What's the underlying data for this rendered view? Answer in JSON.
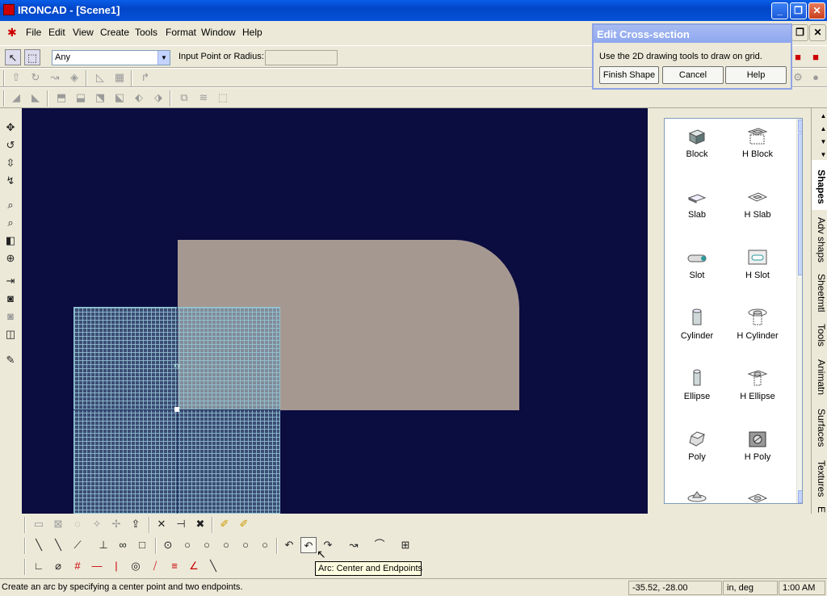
{
  "app": {
    "title": "IRONCAD - [Scene1]"
  },
  "window_buttons": {
    "minimize": "_",
    "restore": "❐",
    "close": "✕"
  },
  "menus": [
    "File",
    "Edit",
    "View",
    "Create",
    "Tools",
    "Format",
    "Window",
    "Help"
  ],
  "selection_toolbar": {
    "filter_value": "Any",
    "input_label": "Input Point or Radius:",
    "input_value": ""
  },
  "dialog": {
    "title": "Edit Cross-section",
    "message": "Use the 2D drawing tools to draw on grid.",
    "buttons": {
      "finish": "Finish Shape",
      "cancel": "Cancel",
      "help": "Help"
    }
  },
  "catalog": {
    "items": [
      {
        "label": "Block",
        "icon": "block-icon"
      },
      {
        "label": "H Block",
        "icon": "h-block-icon"
      },
      {
        "label": "Slab",
        "icon": "slab-icon"
      },
      {
        "label": "H Slab",
        "icon": "h-slab-icon"
      },
      {
        "label": "Slot",
        "icon": "slot-icon"
      },
      {
        "label": "H Slot",
        "icon": "h-slot-icon"
      },
      {
        "label": "Cylinder",
        "icon": "cylinder-icon"
      },
      {
        "label": "H Cylinder",
        "icon": "h-cylinder-icon"
      },
      {
        "label": "Ellipse",
        "icon": "ellipse-icon"
      },
      {
        "label": "H Ellipse",
        "icon": "h-ellipse-icon"
      },
      {
        "label": "Poly",
        "icon": "poly-icon"
      },
      {
        "label": "H Poly",
        "icon": "h-poly-icon"
      }
    ]
  },
  "catalog_tabs": [
    "Shapes",
    "Adv shaps",
    "Sheetmtl",
    "Tools",
    "Animatn",
    "Surfaces",
    "Textures",
    "E"
  ],
  "viewport": {
    "grid_label": "xy"
  },
  "tooltip": "Arc: Center and Endpoints",
  "status": {
    "message": "Create an arc by specifying a center point and two endpoints.",
    "coords": "-35.52, -28.00",
    "units": "in, deg",
    "time": "1:00 AM"
  },
  "colors": {
    "viewport_bg": "#0b0c40",
    "shape": "#a59891",
    "grid": "#8fc6d4",
    "titlebar": "#0a5ee8"
  }
}
